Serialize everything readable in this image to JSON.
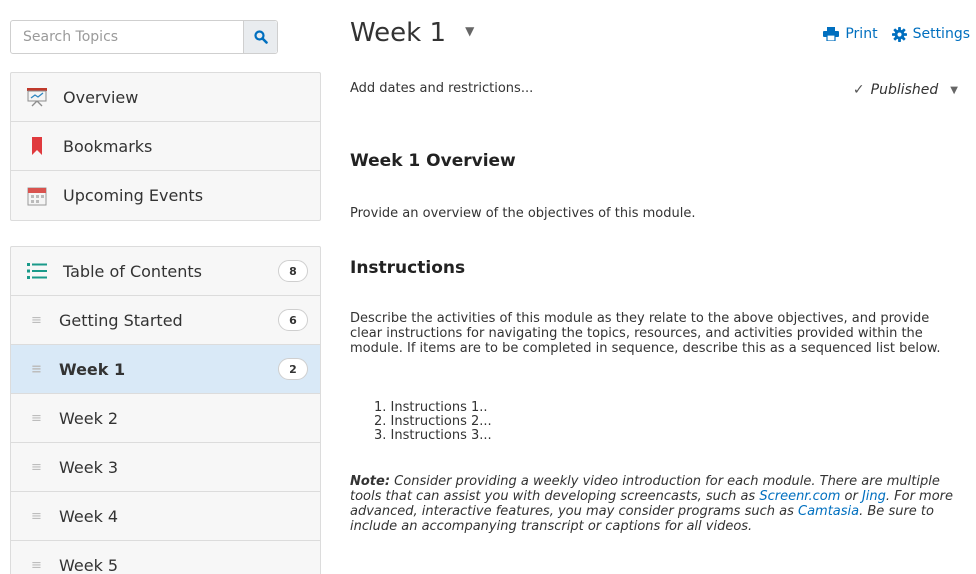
{
  "search": {
    "placeholder": "Search Topics"
  },
  "nav_top": [
    {
      "label": "Overview"
    },
    {
      "label": "Bookmarks"
    },
    {
      "label": "Upcoming Events"
    }
  ],
  "toc": {
    "label": "Table of Contents",
    "count": "8",
    "items": [
      {
        "label": "Getting Started",
        "count": "6"
      },
      {
        "label": "Week 1",
        "count": "2",
        "active": true
      },
      {
        "label": "Week 2"
      },
      {
        "label": "Week 3"
      },
      {
        "label": "Week 4"
      },
      {
        "label": "Week 5"
      }
    ]
  },
  "header": {
    "title": "Week 1",
    "print_label": "Print",
    "settings_label": "Settings"
  },
  "module": {
    "dates_link": "Add dates and restrictions...",
    "status": "Published"
  },
  "content": {
    "overview_heading": "Week 1 Overview",
    "overview_text": "Provide an overview of the objectives of this module.",
    "instructions_heading": "Instructions",
    "instructions_text": "Describe the activities of this module as they relate to the above objectives, and provide clear instructions for navigating the topics, resources, and activities provided within the module. If items are to be completed in sequence, describe this as a sequenced list below.",
    "list": [
      "1. Instructions 1..",
      "2. Instructions 2...",
      "3. Instructions 3..."
    ],
    "note_label": "Note:",
    "note_part1": " Consider providing a weekly video introduction for each module. There are multiple tools that can assist you with developing screencasts, such as ",
    "note_link1": "Screenr.com",
    "note_part2": " or ",
    "note_link2": "Jing",
    "note_part3": ". For more advanced, interactive features, you may consider programs such as ",
    "note_link3": "Camtasia",
    "note_part4": ". Be sure to include an accompanying transcript or captions for all videos."
  },
  "colors": {
    "accent": "#006fbf",
    "active_bg": "#d9e9f7",
    "bookmark_red": "#e03a3e"
  }
}
